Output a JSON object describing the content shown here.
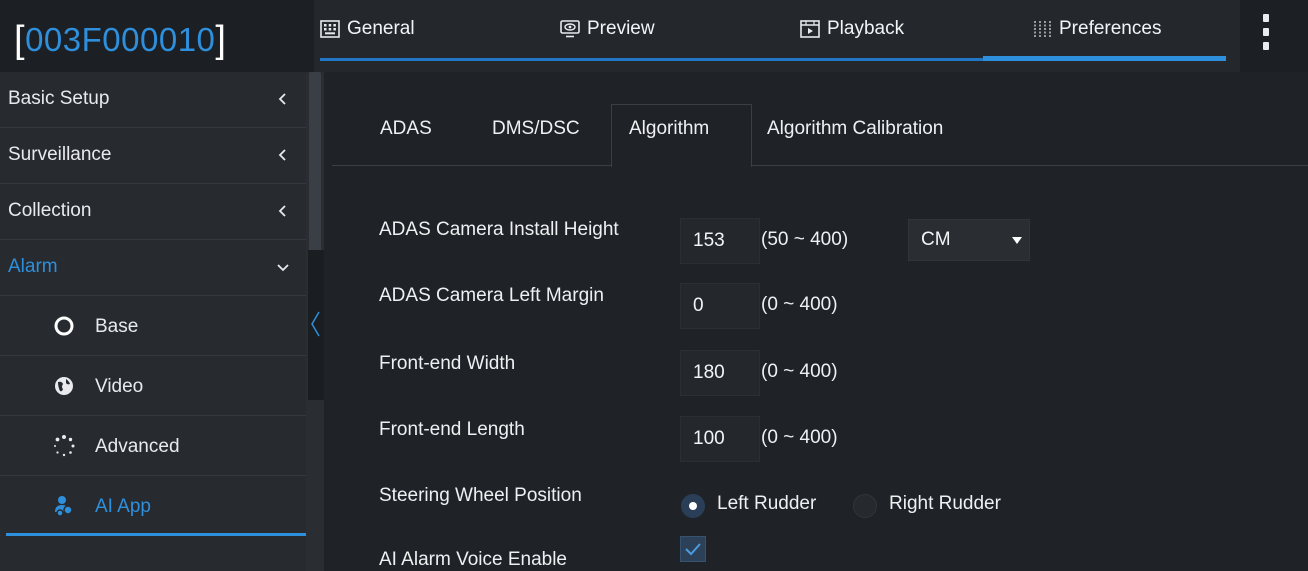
{
  "header": {
    "device_id": "003F000010",
    "bracket_open": "[",
    "bracket_close": "]",
    "tabs": [
      {
        "label": "General",
        "icon": "keyboard-icon"
      },
      {
        "label": "Preview",
        "icon": "eye-monitor-icon"
      },
      {
        "label": "Playback",
        "icon": "playback-icon"
      },
      {
        "label": "Preferences",
        "icon": "sliders-icon",
        "active": true
      }
    ],
    "menu_icon": "more-vertical-icon"
  },
  "sidebar": {
    "items": [
      {
        "label": "Basic Setup",
        "icon": "chevron-left-icon"
      },
      {
        "label": "Surveillance",
        "icon": "chevron-left-icon"
      },
      {
        "label": "Collection",
        "icon": "chevron-left-icon"
      },
      {
        "label": "Alarm",
        "icon": "chevron-down-icon",
        "expanded": true
      }
    ],
    "sub_items": [
      {
        "label": "Base",
        "icon": "circle-icon"
      },
      {
        "label": "Video",
        "icon": "globe-icon"
      },
      {
        "label": "Advanced",
        "icon": "dotted-circle-icon"
      },
      {
        "label": "AI App",
        "icon": "users-icon",
        "active": true
      }
    ]
  },
  "content": {
    "tabs": [
      {
        "label": "ADAS"
      },
      {
        "label": "DMS/DSC"
      },
      {
        "label": "Algorithm",
        "active": true
      },
      {
        "label": "Algorithm Calibration"
      }
    ],
    "form": {
      "install_height": {
        "label": "ADAS Camera Install Height",
        "value": "153",
        "range": "(50 ~ 400)",
        "unit": "CM"
      },
      "left_margin": {
        "label": "ADAS Camera Left Margin",
        "value": "0",
        "range": "(0 ~ 400)"
      },
      "front_width": {
        "label": "Front-end Width",
        "value": "180",
        "range": "(0 ~ 400)"
      },
      "front_length": {
        "label": "Front-end Length",
        "value": "100",
        "range": "(0 ~ 400)"
      },
      "steering": {
        "label": "Steering Wheel Position",
        "options": [
          "Left Rudder",
          "Right Rudder"
        ],
        "selected": "Left Rudder"
      },
      "voice": {
        "label": "AI Alarm Voice Enable",
        "checked": true
      }
    }
  },
  "colors": {
    "accent": "#2e8fdc",
    "background": "#1f2226",
    "sidebar": "#272b30"
  }
}
